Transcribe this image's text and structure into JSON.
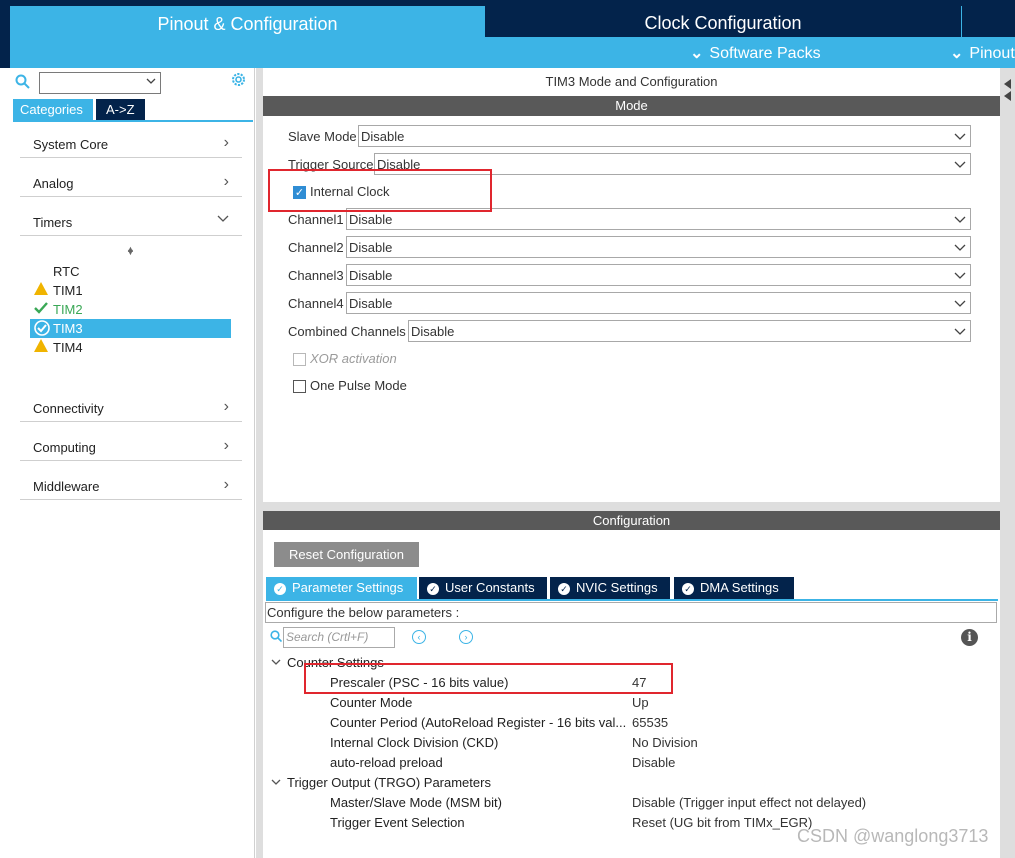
{
  "top_tabs": {
    "pinout": "Pinout & Configuration",
    "clock": "Clock Configuration"
  },
  "sub_menu": {
    "software_packs": "Software Packs",
    "pinout": "Pinout"
  },
  "left": {
    "tabs": [
      "Categories",
      "A->Z"
    ],
    "categories": [
      {
        "label": "System Core",
        "expanded": false
      },
      {
        "label": "Analog",
        "expanded": false
      },
      {
        "label": "Timers",
        "expanded": true
      },
      {
        "label": "Connectivity",
        "expanded": false
      },
      {
        "label": "Computing",
        "expanded": false
      },
      {
        "label": "Middleware",
        "expanded": false
      }
    ],
    "timers": [
      {
        "label": "RTC",
        "status": "none"
      },
      {
        "label": "TIM1",
        "status": "warning"
      },
      {
        "label": "TIM2",
        "status": "ok"
      },
      {
        "label": "TIM3",
        "status": "selected"
      },
      {
        "label": "TIM4",
        "status": "warning"
      }
    ]
  },
  "mode": {
    "title": "TIM3 Mode and Configuration",
    "header": "Mode",
    "slave_mode": {
      "label": "Slave Mode",
      "value": "Disable"
    },
    "trigger_source": {
      "label": "Trigger Source",
      "value": "Disable"
    },
    "internal_clock": {
      "label": "Internal Clock",
      "checked": true
    },
    "channels": [
      {
        "label": "Channel1",
        "value": "Disable"
      },
      {
        "label": "Channel2",
        "value": "Disable"
      },
      {
        "label": "Channel3",
        "value": "Disable"
      },
      {
        "label": "Channel4",
        "value": "Disable"
      }
    ],
    "combined_channels": {
      "label": "Combined Channels",
      "value": "Disable"
    },
    "xor_activation": {
      "label": "XOR activation",
      "checked": false,
      "disabled": true
    },
    "one_pulse": {
      "label": "One Pulse Mode",
      "checked": false
    }
  },
  "config": {
    "header": "Configuration",
    "reset_label": "Reset Configuration",
    "tabs": [
      "Parameter Settings",
      "User Constants",
      "NVIC Settings",
      "DMA Settings"
    ],
    "description": "Configure the below parameters :",
    "search_placeholder": "Search (Crtl+F)",
    "groups": [
      {
        "title": "Counter Settings",
        "params": [
          {
            "name": "Prescaler (PSC - 16 bits value)",
            "value": "47"
          },
          {
            "name": "Counter Mode",
            "value": "Up"
          },
          {
            "name": "Counter Period (AutoReload Register - 16 bits val...",
            "value": "65535"
          },
          {
            "name": "Internal Clock Division (CKD)",
            "value": "No Division"
          },
          {
            "name": "auto-reload preload",
            "value": "Disable"
          }
        ]
      },
      {
        "title": "Trigger Output (TRGO) Parameters",
        "params": [
          {
            "name": "Master/Slave Mode (MSM bit)",
            "value": "Disable (Trigger input effect not delayed)"
          },
          {
            "name": "Trigger Event Selection",
            "value": "Reset (UG bit from TIMx_EGR)"
          }
        ]
      }
    ]
  },
  "watermark": "CSDN @wanglong3713",
  "colors": {
    "accent": "#3cb4e6",
    "navy": "#03234b",
    "highlight": "#e0262e"
  }
}
